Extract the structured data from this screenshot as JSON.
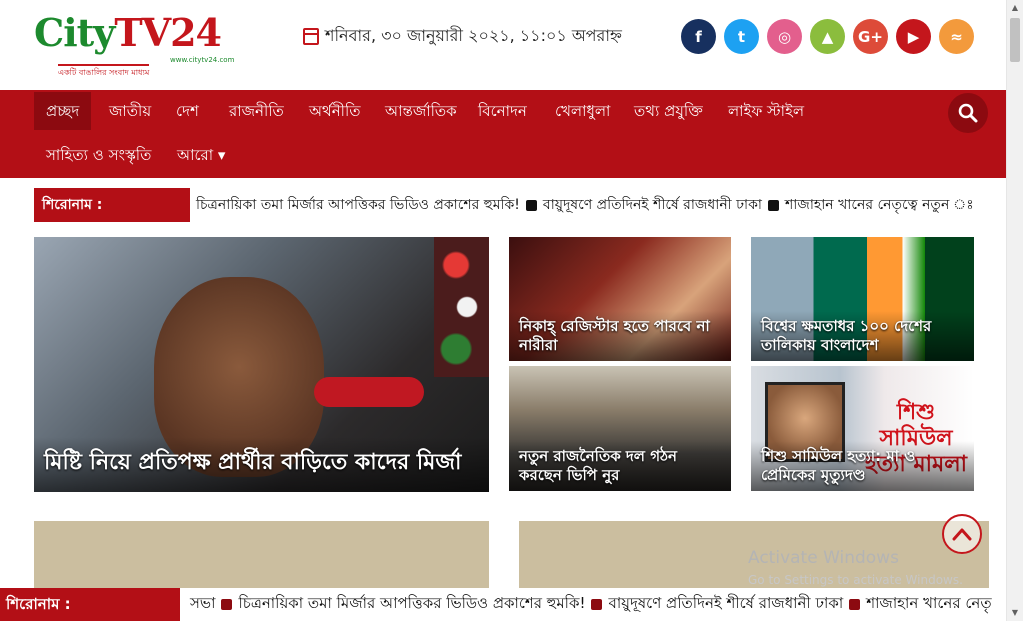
{
  "logo": {
    "name_part1": "City",
    "name_part2": "TV24",
    "tagline": "একটি বাঙালির সংবাদ মাধ্যম",
    "url": "www.citytv24.com"
  },
  "header": {
    "date": "শনিবার, ৩০ জানুয়ারী ২০২১, ১১:০১ অপরাহ্ন"
  },
  "social": [
    {
      "name": "facebook-icon",
      "glyph": "f",
      "color": "#17305f"
    },
    {
      "name": "twitter-icon",
      "glyph": "t",
      "color": "#1da1f2"
    },
    {
      "name": "instagram-icon",
      "glyph": "◎",
      "color": "#e35f8d"
    },
    {
      "name": "android-icon",
      "glyph": "▲",
      "color": "#8bbd3d"
    },
    {
      "name": "google-plus-icon",
      "glyph": "G+",
      "color": "#dd4b39"
    },
    {
      "name": "youtube-icon",
      "glyph": "▶",
      "color": "#c4161c"
    },
    {
      "name": "rss-icon",
      "glyph": "≈",
      "color": "#f39a3c"
    }
  ],
  "nav": {
    "items": [
      "প্রচ্ছদ",
      "জাতীয়",
      "দেশ",
      "রাজনীতি",
      "অর্থনীতি",
      "আন্তর্জাতিক",
      "বিনোদন",
      "খেলাধুলা",
      "তথ্য প্রযুক্তি",
      "লাইফ স্টাইল"
    ],
    "row2": [
      "সাহিত্য ও সংস্কৃতি",
      "আরো ▾"
    ]
  },
  "ticker": {
    "label": "শিরোনাম :",
    "items": [
      "চিত্রনায়িকা তমা মির্জার আপত্তিকর ভিডিও প্রকাশের হুমকি!",
      "বায়ুদূষণে প্রতিদিনই শীর্ষে রাজধানী ঢাকা",
      "শাজাহান খানের নেতৃত্বে নতুন ঃ"
    ]
  },
  "news": {
    "lead": "মিষ্টি নিয়ে প্রতিপক্ষ প্রার্থীর বাড়িতে কাদের মির্জা",
    "c1": "নিকাহ্ রেজিস্টার হতে পারবে না নারীরা",
    "c2": "বিশ্বের ক্ষমতাধর ১০০ দেশের তালিকায় বাংলাদেশ",
    "c3": "নতুন রাজনৈতিক দল গঠন করছেন ভিপি নুর",
    "c4": "শিশু সামিউল হত্যা: মা ও প্রেমিকের মৃত্যুদণ্ড",
    "c4_image_text": "শিশু সামিউল হত্যা মামলা"
  },
  "watermark": {
    "line1": "Activate Windows",
    "line2": "Go to Settings to activate Windows."
  },
  "bottom_ticker": {
    "label": "শিরোনাম :",
    "lead_word": "সভা",
    "items": [
      "চিত্রনায়িকা তমা মির্জার আপত্তিকর ভিডিও প্রকাশের হুমকি!",
      "বায়ুদূষণে প্রতিদিনই শীর্ষে রাজধানী ঢাকা",
      "শাজাহান খানের নেতৃ"
    ]
  }
}
